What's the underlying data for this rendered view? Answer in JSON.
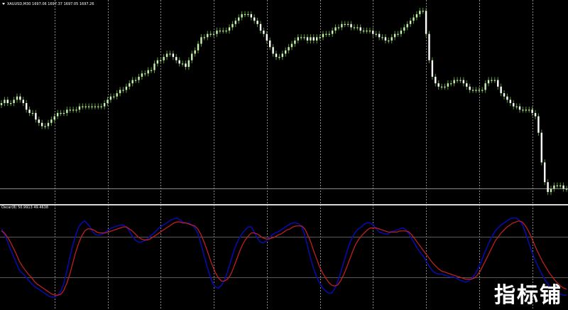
{
  "main_label": "XAUUSD,M30  1697.06 1697.37 1697.05 1697.26",
  "indicator_label": "Oscar(8) 50.9913 49.4638",
  "watermark": "指标铺",
  "colors": {
    "background": "#000000",
    "bull_candle": "#c8f0b4",
    "bear_candle": "#ffffff",
    "wick": "#5a9a3a",
    "fast_line": "#0a0aa8",
    "slow_line": "#cc2020",
    "grid": "#8a8a8a",
    "separator": "#d8d8d8"
  },
  "chart_data": [
    {
      "type": "candlestick",
      "title": "XAUUSD,M30",
      "ohlc_last": {
        "open": 1697.06,
        "high": 1697.37,
        "low": 1697.05,
        "close": 1697.26
      },
      "series": [
        {
          "close": [
            1706,
            1707,
            1706,
            1706,
            1707,
            1708,
            1707,
            1706,
            1704,
            1703,
            1703,
            1701,
            1700,
            1699,
            1699,
            1700,
            1701,
            1702,
            1703,
            1703,
            1703,
            1704,
            1704,
            1704,
            1704,
            1705,
            1705,
            1705,
            1705,
            1705,
            1705,
            1705,
            1705,
            1706,
            1707,
            1708,
            1708,
            1709,
            1710,
            1710,
            1711,
            1712,
            1713,
            1713,
            1714,
            1715,
            1715,
            1716,
            1716,
            1718,
            1719,
            1719,
            1720,
            1721,
            1721,
            1720,
            1719,
            1718,
            1718,
            1717,
            1719,
            1721,
            1722,
            1724,
            1726,
            1726,
            1727,
            1727,
            1727,
            1728,
            1728,
            1728,
            1728,
            1729,
            1730,
            1731,
            1732,
            1733,
            1733,
            1733,
            1732,
            1731,
            1730,
            1728,
            1727,
            1725,
            1723,
            1721,
            1720,
            1720,
            1721,
            1722,
            1723,
            1724,
            1725,
            1726,
            1726,
            1726,
            1725,
            1726,
            1725,
            1726,
            1726,
            1727,
            1727,
            1727,
            1728,
            1729,
            1729,
            1730,
            1730,
            1730,
            1729,
            1729,
            1729,
            1728,
            1728,
            1728,
            1728,
            1727,
            1727,
            1726,
            1726,
            1725,
            1725,
            1726,
            1727,
            1727,
            1728,
            1729,
            1730,
            1731,
            1732,
            1733,
            1734,
            1734,
            1727,
            1719,
            1714,
            1712,
            1711,
            1711,
            1711,
            1712,
            1712,
            1713,
            1713,
            1713,
            1712,
            1711,
            1710,
            1710,
            1710,
            1710,
            1710,
            1712,
            1713,
            1713,
            1713,
            1711,
            1709,
            1708,
            1707,
            1706,
            1705,
            1705,
            1704,
            1704,
            1704,
            1704,
            1703,
            1702,
            1697,
            1688,
            1682,
            1679,
            1680,
            1681,
            1681,
            1681,
            1680,
            1680
          ],
          "name": ""
        }
      ]
    },
    {
      "type": "line",
      "title": "Oscar(8)",
      "current_values": [
        50.9913,
        49.4638
      ],
      "ylim": [
        0,
        100
      ],
      "levels": [
        70,
        30
      ],
      "series": [
        {
          "name": "",
          "values": [
            78,
            73,
            66,
            58,
            51,
            44,
            37,
            34,
            31,
            27,
            24,
            21,
            19,
            17,
            15,
            13,
            11,
            10,
            10,
            12,
            16,
            24,
            36,
            50,
            62,
            72,
            80,
            84,
            86,
            83,
            79,
            74,
            72,
            72,
            73,
            75,
            77,
            79,
            80,
            81,
            82,
            82,
            80,
            76,
            71,
            67,
            65,
            65,
            66,
            68,
            71,
            73,
            76,
            79,
            81,
            83,
            85,
            87,
            88,
            89,
            87,
            85,
            84,
            84,
            82,
            79,
            74,
            64,
            53,
            42,
            32,
            24,
            20,
            19,
            22,
            27,
            35,
            45,
            55,
            63,
            69,
            74,
            77,
            80,
            80,
            75,
            69,
            65,
            64,
            66,
            69,
            72,
            74,
            75,
            77,
            79,
            81,
            83,
            84,
            84,
            83,
            80,
            72,
            60,
            48,
            38,
            30,
            24,
            19,
            16,
            14,
            14,
            18,
            25,
            34,
            44,
            54,
            63,
            70,
            75,
            78,
            80,
            83,
            84,
            84,
            82,
            78,
            75,
            74,
            73,
            73,
            75,
            76,
            77,
            78,
            79,
            77,
            73,
            68,
            63,
            58,
            54,
            50,
            45,
            40,
            36,
            34,
            33,
            33,
            32,
            31,
            30,
            30,
            29,
            27,
            26,
            25,
            26,
            28,
            32,
            37,
            43,
            51,
            58,
            65,
            71,
            76,
            79,
            82,
            84,
            86,
            88,
            89,
            89,
            87,
            83,
            76,
            67,
            58,
            50,
            43,
            37,
            31,
            26,
            22,
            18,
            16,
            14,
            13,
            12,
            12
          ]
        },
        {
          "name": "",
          "values": [
            76,
            74,
            70,
            65,
            59,
            53,
            46,
            41,
            37,
            33,
            30,
            26,
            23,
            21,
            19,
            17,
            15,
            13,
            12,
            12,
            13,
            17,
            24,
            33,
            44,
            55,
            64,
            71,
            76,
            78,
            78,
            77,
            75,
            74,
            74,
            74,
            75,
            76,
            77,
            78,
            79,
            80,
            80,
            78,
            76,
            73,
            70,
            68,
            67,
            67,
            68,
            70,
            72,
            74,
            76,
            78,
            80,
            82,
            84,
            85,
            85,
            84,
            84,
            83,
            82,
            81,
            78,
            73,
            66,
            58,
            49,
            41,
            34,
            29,
            26,
            26,
            28,
            32,
            39,
            47,
            55,
            62,
            67,
            71,
            74,
            74,
            73,
            71,
            69,
            68,
            68,
            69,
            70,
            72,
            73,
            75,
            77,
            78,
            80,
            81,
            81,
            81,
            78,
            72,
            65,
            56,
            48,
            40,
            34,
            29,
            25,
            22,
            21,
            22,
            26,
            32,
            39,
            47,
            55,
            62,
            67,
            71,
            74,
            77,
            79,
            79,
            79,
            78,
            77,
            76,
            75,
            75,
            75,
            75,
            76,
            76,
            76,
            75,
            72,
            68,
            64,
            60,
            56,
            52,
            48,
            44,
            41,
            38,
            36,
            35,
            34,
            33,
            32,
            31,
            30,
            29,
            28,
            28,
            28,
            29,
            32,
            36,
            42,
            48,
            54,
            60,
            66,
            70,
            74,
            77,
            80,
            82,
            84,
            85,
            86,
            85,
            82,
            77,
            71,
            64,
            57,
            51,
            45,
            40,
            35,
            31,
            27,
            24,
            21,
            19,
            18
          ]
        }
      ]
    }
  ]
}
